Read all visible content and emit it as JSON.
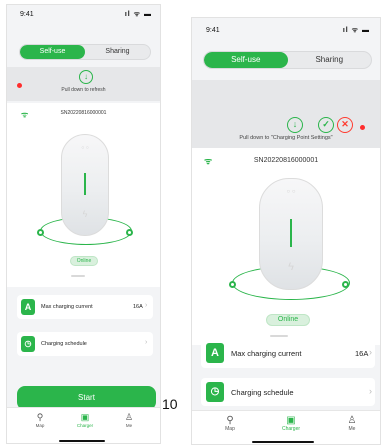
{
  "status_bar": {
    "time": "9:41",
    "icons": "ıl ᯤ ▬"
  },
  "tabs": {
    "self_use": "Self-use",
    "sharing": "Sharing"
  },
  "left_screen": {
    "pull_hint": "Pull down to refresh",
    "serial": "SN20220816000001",
    "status": "Online",
    "max_current_label": "Max charging current",
    "max_current_value": "16A",
    "schedule_label": "Charging schedule",
    "start_button": "Start"
  },
  "right_screen": {
    "pull_hint": "Pull down to \"Charging Point Settings\"",
    "serial": "SN20220816000001",
    "status": "Online",
    "max_current_label": "Max charging current",
    "max_current_value": "16A",
    "schedule_label": "Charging schedule"
  },
  "bottom_nav": {
    "map": "Map",
    "charger": "Charger",
    "me": "Me"
  },
  "page_number": "10",
  "icons": {
    "refresh": "arrow-down-circle-icon",
    "confirm": "check-circle-icon",
    "cancel": "x-circle-icon",
    "wifi": "wifi-icon",
    "current": "a-letter-icon",
    "schedule": "clock-icon",
    "map": "map-pin-icon",
    "charger": "charger-icon",
    "me": "person-icon"
  },
  "colors": {
    "accent": "#2bb54b",
    "alert": "#ff2d2d",
    "background": "#f3f4f6"
  }
}
